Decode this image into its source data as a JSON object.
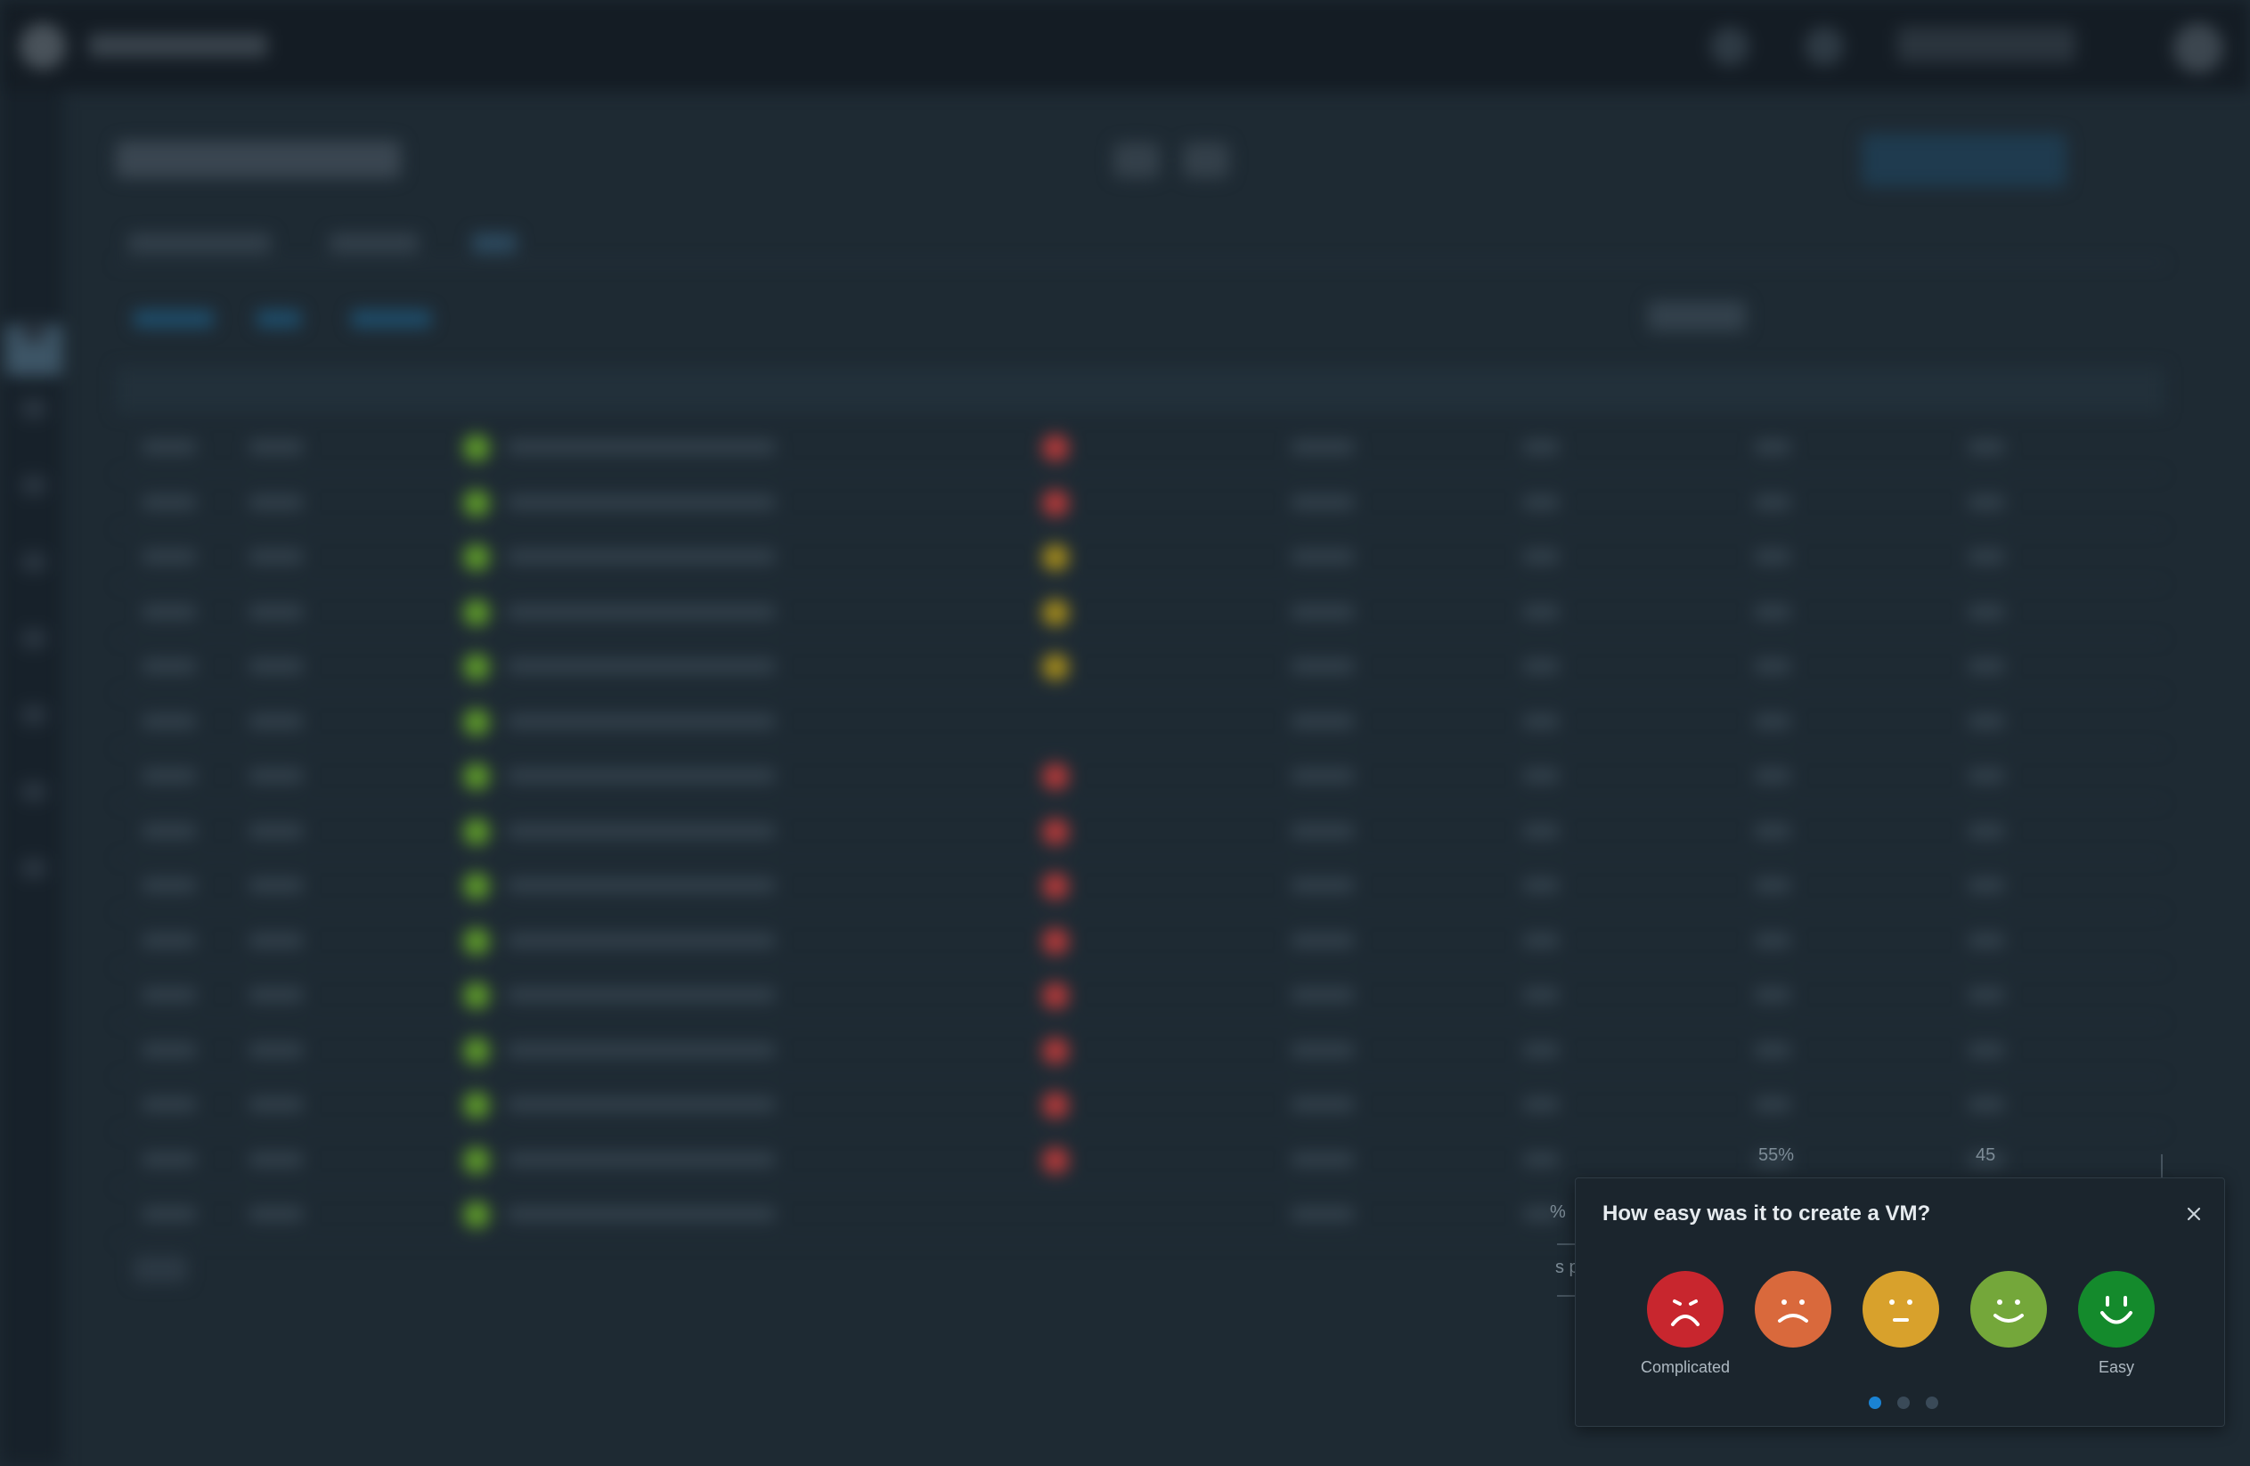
{
  "survey": {
    "question": "How easy was it to create a VM?",
    "ratings": [
      {
        "name": "very-sad",
        "color": "#c8262e"
      },
      {
        "name": "sad",
        "color": "#d9693c"
      },
      {
        "name": "neutral",
        "color": "#d8a12c"
      },
      {
        "name": "happy",
        "color": "#74a73a"
      },
      {
        "name": "very-happy",
        "color": "#148a2c"
      }
    ],
    "label_low": "Complicated",
    "label_high": "Easy",
    "pagination": {
      "current": 1,
      "total": 3,
      "active_color": "#1a83d4",
      "inactive_color": "#3a4a58"
    }
  },
  "background": {
    "peek_texts": [
      "55%",
      "45",
      "%",
      "s p"
    ],
    "status_colors": {
      "ok": "#5f9c2a",
      "error": "#b53a3a",
      "warning": "#a58c1c"
    }
  }
}
